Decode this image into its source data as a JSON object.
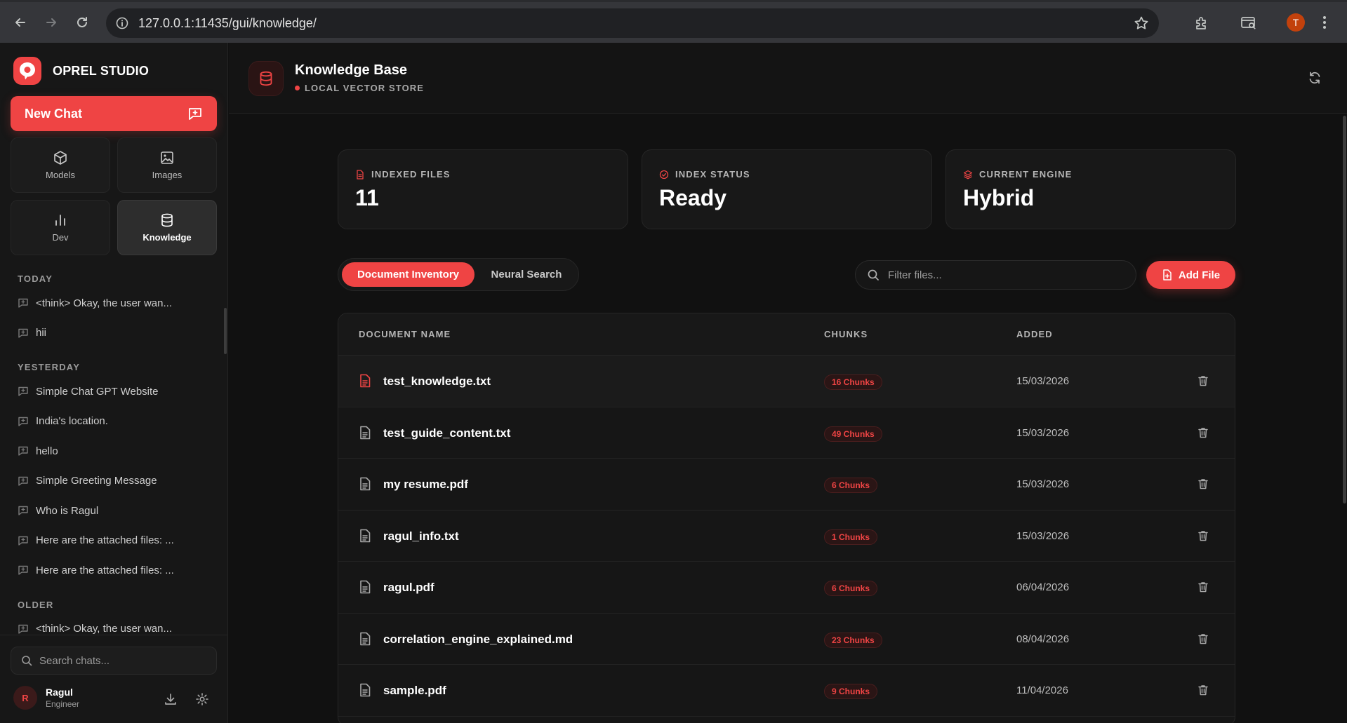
{
  "browser": {
    "url": "127.0.0.1:11435/gui/knowledge/",
    "profile_initial": "T"
  },
  "sidebar": {
    "brand_name": "OPREL STUDIO",
    "new_chat_label": "New Chat",
    "tiles": [
      {
        "label": "Models",
        "icon": "cube-icon"
      },
      {
        "label": "Images",
        "icon": "image-icon"
      },
      {
        "label": "Dev",
        "icon": "bar-chart-icon"
      },
      {
        "label": "Knowledge",
        "icon": "database-icon",
        "active": true
      }
    ],
    "history": [
      {
        "section": "TODAY",
        "items": [
          "<think> Okay, the user wan...",
          "hii"
        ]
      },
      {
        "section": "YESTERDAY",
        "items": [
          "Simple Chat GPT Website",
          "India's location.",
          "hello",
          "Simple Greeting Message",
          "Who is Ragul",
          "Here are the attached files: ...",
          "Here are the attached files: ..."
        ]
      },
      {
        "section": "OLDER",
        "items": [
          "<think> Okay, the user wan..."
        ]
      }
    ],
    "search_placeholder": "Search chats...",
    "user": {
      "initial": "R",
      "name": "Ragul",
      "role": "Engineer"
    }
  },
  "header": {
    "title": "Knowledge Base",
    "subtitle": "LOCAL VECTOR STORE"
  },
  "stats": [
    {
      "label": "INDEXED FILES",
      "value": "11",
      "icon": "file-icon"
    },
    {
      "label": "INDEX STATUS",
      "value": "Ready",
      "icon": "check-circle-icon"
    },
    {
      "label": "CURRENT ENGINE",
      "value": "Hybrid",
      "icon": "layers-icon"
    }
  ],
  "tabs": {
    "active": "Document Inventory",
    "inactive": "Neural Search"
  },
  "filter": {
    "placeholder": "Filter files..."
  },
  "add_file_label": "Add File",
  "table": {
    "columns": {
      "name": "DOCUMENT NAME",
      "chunks": "CHUNKS",
      "added": "ADDED"
    },
    "rows": [
      {
        "name": "test_knowledge.txt",
        "chunks": "16 Chunks",
        "added": "15/03/2026"
      },
      {
        "name": "test_guide_content.txt",
        "chunks": "49 Chunks",
        "added": "15/03/2026"
      },
      {
        "name": "my resume.pdf",
        "chunks": "6 Chunks",
        "added": "15/03/2026"
      },
      {
        "name": "ragul_info.txt",
        "chunks": "1 Chunks",
        "added": "15/03/2026"
      },
      {
        "name": "ragul.pdf",
        "chunks": "6 Chunks",
        "added": "06/04/2026"
      },
      {
        "name": "correlation_engine_explained.md",
        "chunks": "23 Chunks",
        "added": "08/04/2026"
      },
      {
        "name": "sample.pdf",
        "chunks": "9 Chunks",
        "added": "11/04/2026"
      }
    ]
  },
  "colors": {
    "accent": "#ef4444",
    "background": "#111111",
    "sidebar": "#171717"
  }
}
